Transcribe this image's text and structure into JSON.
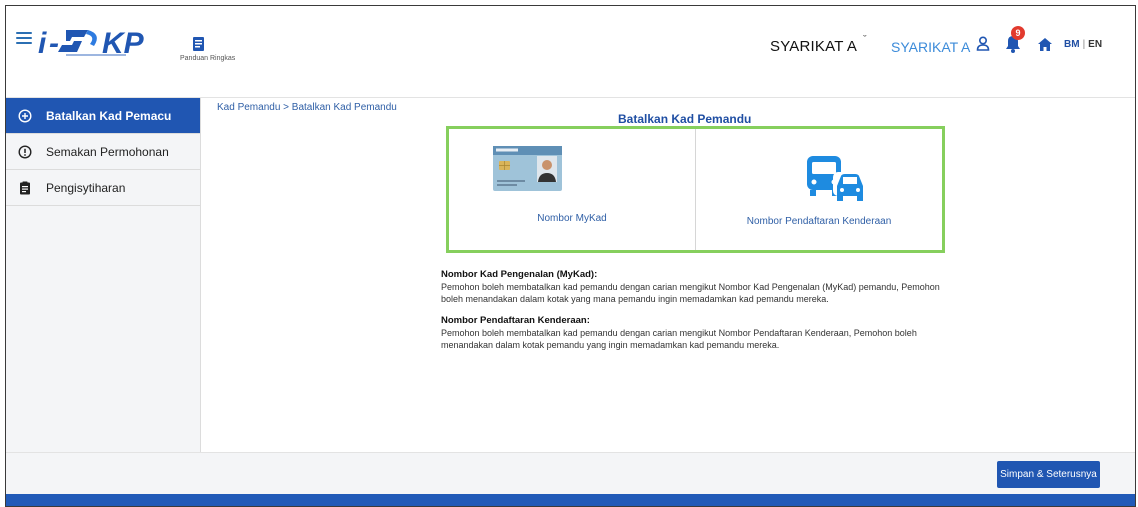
{
  "header": {
    "guide_label": "Panduan Ringkas",
    "company_name": "SYARIKAT A",
    "company_caret": "ˇ",
    "company_select": "SYARIKAT A",
    "notification_count": "9",
    "lang_bm": "BM",
    "lang_sep": "|",
    "lang_en": "EN"
  },
  "sidebar": {
    "items": [
      {
        "label": "Batalkan Kad Pemacu",
        "icon": "plus-circle-icon",
        "active": true
      },
      {
        "label": "Semakan Permohonan",
        "icon": "info-circle-icon",
        "active": false
      },
      {
        "label": "Pengisytiharan",
        "icon": "clipboard-icon",
        "active": false
      }
    ]
  },
  "main": {
    "breadcrumb": "Kad Pemandu > Batalkan Kad Pemandu",
    "title": "Batalkan Kad Pemandu",
    "options": [
      {
        "label": "Nombor MyKad",
        "icon": "mykad-card-icon"
      },
      {
        "label": "Nombor Pendaftaran Kenderaan",
        "icon": "vehicle-icon"
      }
    ],
    "desc": [
      {
        "heading": "Nombor Kad Pengenalan (MyKad):",
        "body": "Pemohon boleh membatalkan kad pemandu dengan carian mengikut Nombor Kad Pengenalan (MyKad) pemandu, Pemohon boleh menandakan dalam kotak yang mana pemandu ingin memadamkan kad pemandu mereka."
      },
      {
        "heading": "Nombor Pendaftaran Kenderaan:",
        "body": "Pemohon boleh membatalkan kad pemandu dengan carian mengikut Nombor Pendaftaran Kenderaan, Pemohon boleh menandakan dalam kotak pemandu yang ingin memadamkan kad pemandu mereka."
      }
    ]
  },
  "footer": {
    "next_button": "Simpan & Seterusnya"
  },
  "colors": {
    "primary": "#2056b2",
    "accent_green": "#86cf5d",
    "link": "#3c8bd9",
    "badge": "#e23a2e"
  }
}
